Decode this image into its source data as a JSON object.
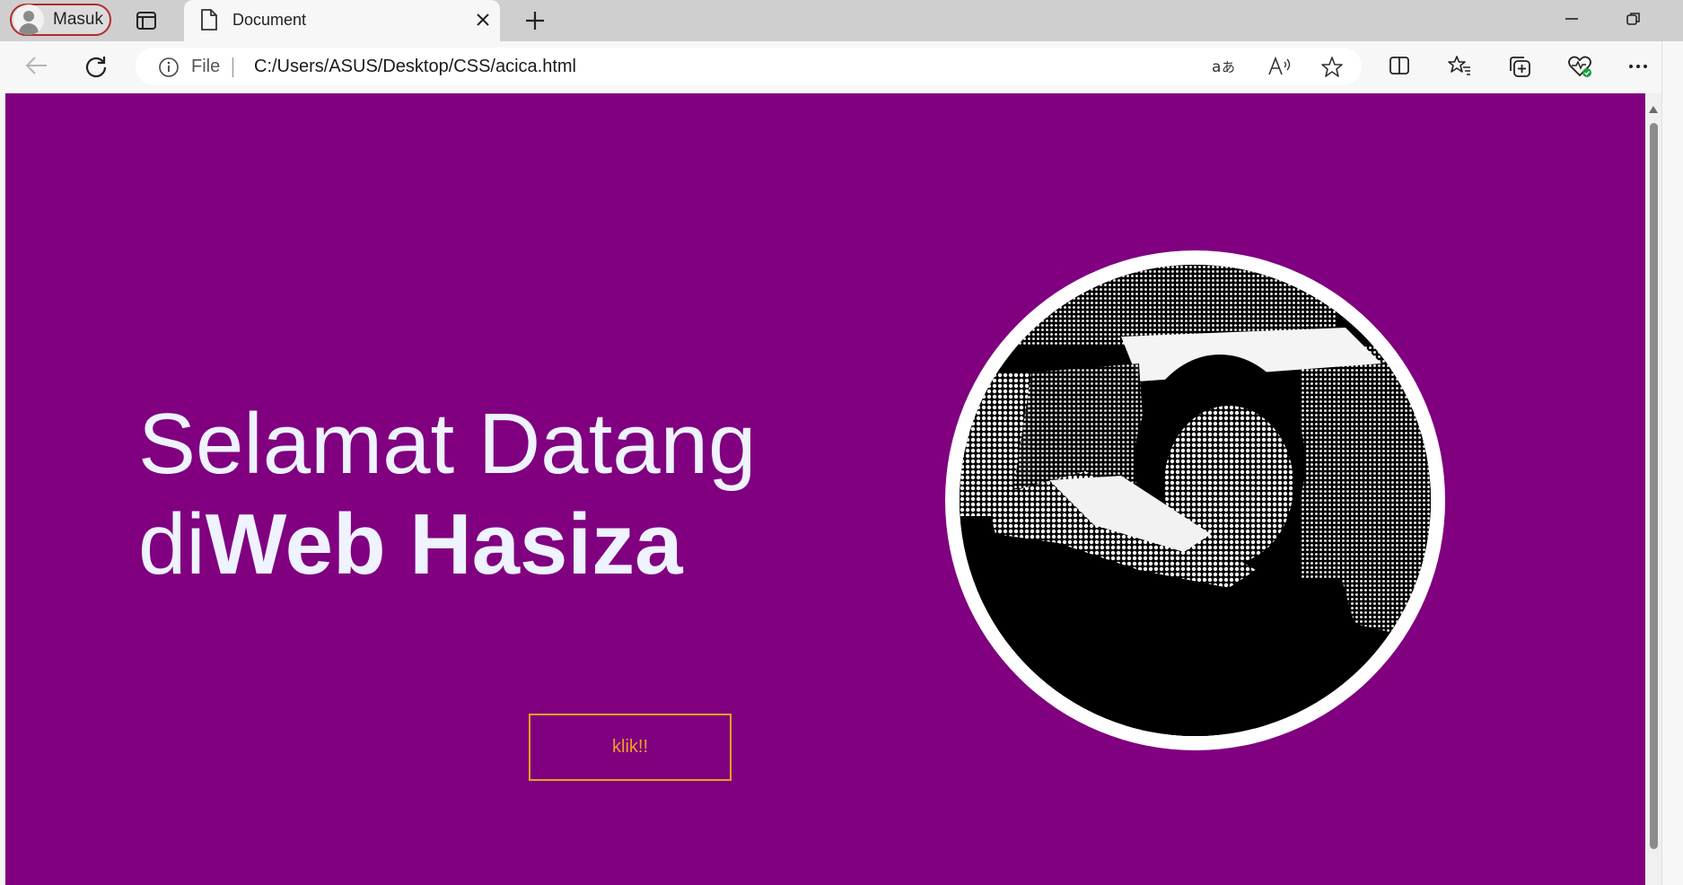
{
  "browser": {
    "profile_label": "Masuk",
    "tab_title": "Document",
    "address": {
      "scheme_label": "File",
      "url": "C:/Users/ASUS/Desktop/CSS/acica.html"
    }
  },
  "page": {
    "background_color": "#800080",
    "heading_line1": "Selamat Datang",
    "heading_prefix": "di",
    "heading_bold": "Web Hasiza",
    "button_label": "klik!!",
    "button_color": "#e6a21a"
  },
  "icons": {
    "profile": "person-icon",
    "tab_actions": "tab-actions-icon",
    "document": "document-icon",
    "close": "close-icon",
    "new_tab": "plus-icon",
    "back": "back-arrow-icon",
    "refresh": "refresh-icon",
    "info": "info-icon",
    "translate": "translate-icon",
    "read_aloud": "read-aloud-icon",
    "favorite": "star-icon",
    "split": "split-screen-icon",
    "favorites": "favorites-icon",
    "collections": "collections-icon",
    "performance": "heart-pulse-icon",
    "more": "more-icon"
  }
}
